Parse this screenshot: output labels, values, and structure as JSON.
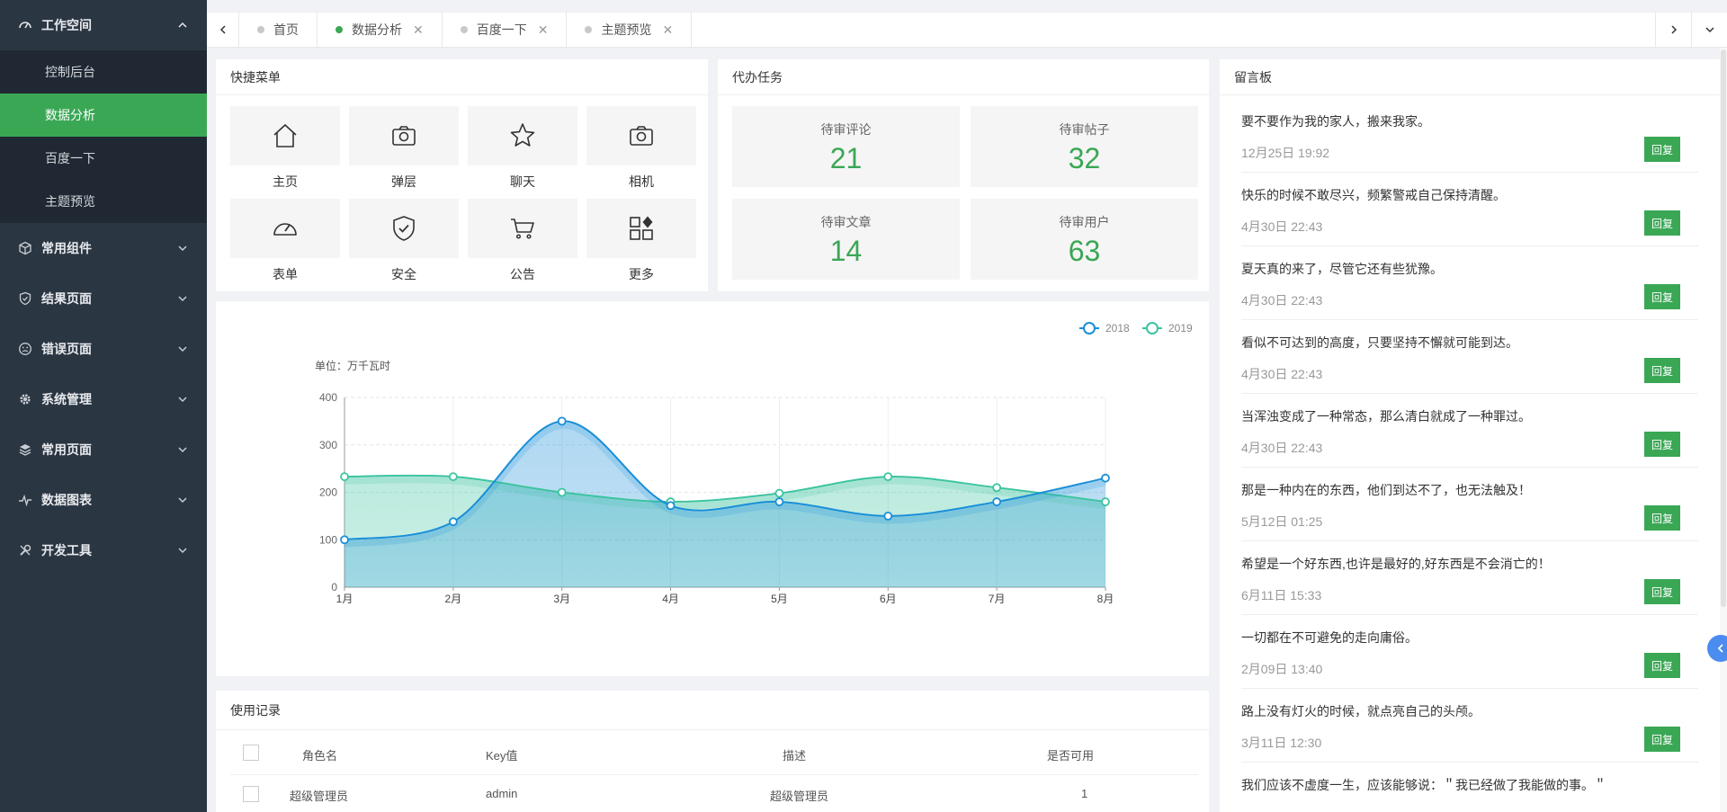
{
  "sidebar": {
    "workspace": {
      "label": "工作空间",
      "items": [
        "控制后台",
        "数据分析",
        "百度一下",
        "主题预览"
      ],
      "active_index": 1
    },
    "groups": [
      {
        "label": "常用组件",
        "icon": "cube-icon"
      },
      {
        "label": "结果页面",
        "icon": "shield-check-icon"
      },
      {
        "label": "错误页面",
        "icon": "sad-face-icon"
      },
      {
        "label": "系统管理",
        "icon": "gear-icon"
      },
      {
        "label": "常用页面",
        "icon": "layers-icon"
      },
      {
        "label": "数据图表",
        "icon": "pulse-icon"
      },
      {
        "label": "开发工具",
        "icon": "tools-icon"
      }
    ]
  },
  "tabs": [
    {
      "label": "首页",
      "closable": false,
      "active": false
    },
    {
      "label": "数据分析",
      "closable": true,
      "active": true
    },
    {
      "label": "百度一下",
      "closable": true,
      "active": false
    },
    {
      "label": "主题预览",
      "closable": true,
      "active": false
    }
  ],
  "tab_close_glyph": "✕",
  "quick_menu": {
    "title": "快捷菜单",
    "items": [
      {
        "label": "主页",
        "icon": "home-icon"
      },
      {
        "label": "弹层",
        "icon": "camera-icon"
      },
      {
        "label": "聊天",
        "icon": "star-icon"
      },
      {
        "label": "相机",
        "icon": "camera-icon"
      },
      {
        "label": "表单",
        "icon": "gauge-icon"
      },
      {
        "label": "安全",
        "icon": "shield-icon"
      },
      {
        "label": "公告",
        "icon": "cart-icon"
      },
      {
        "label": "更多",
        "icon": "apps-icon"
      }
    ]
  },
  "tasks": {
    "title": "代办任务",
    "items": [
      {
        "label": "待审评论",
        "value": "21"
      },
      {
        "label": "待审帖子",
        "value": "32"
      },
      {
        "label": "待审文章",
        "value": "14"
      },
      {
        "label": "待审用户",
        "value": "63"
      }
    ]
  },
  "board": {
    "title": "留言板",
    "reply_label": "回复",
    "messages": [
      {
        "text": "要不要作为我的家人，搬来我家。",
        "time": "12月25日 19:92"
      },
      {
        "text": "快乐的时候不敢尽兴，频繁警戒自己保持清醒。",
        "time": "4月30日 22:43"
      },
      {
        "text": "夏天真的来了，尽管它还有些犹豫。",
        "time": "4月30日 22:43"
      },
      {
        "text": "看似不可达到的高度，只要坚持不懈就可能到达。",
        "time": "4月30日 22:43"
      },
      {
        "text": "当浑浊变成了一种常态，那么清白就成了一种罪过。",
        "time": "4月30日 22:43"
      },
      {
        "text": "那是一种内在的东西，他们到达不了，也无法触及！",
        "time": "5月12日 01:25"
      },
      {
        "text": "希望是一个好东西,也许是最好的,好东西是不会消亡的！",
        "time": "6月11日 15:33"
      },
      {
        "text": "一切都在不可避免的走向庸俗。",
        "time": "2月09日 13:40"
      },
      {
        "text": "路上没有灯火的时候，就点亮自己的头颅。",
        "time": "3月11日 12:30"
      },
      {
        "text": "我们应该不虚度一生，应该能够说：＂我已经做了我能做的事。＂",
        "time": ""
      }
    ]
  },
  "chart_data": {
    "type": "line",
    "unit_label": "单位：万千瓦时",
    "categories": [
      "1月",
      "2月",
      "3月",
      "4月",
      "5月",
      "6月",
      "7月",
      "8月"
    ],
    "series": [
      {
        "name": "2018",
        "values": [
          100,
          138,
          350,
          172,
          180,
          150,
          180,
          230
        ],
        "color": "#1a8fd8"
      },
      {
        "name": "2019",
        "values": [
          233,
          233,
          200,
          180,
          198,
          233,
          210,
          180
        ],
        "color": "#3cc4a0"
      }
    ],
    "yticks": [
      0,
      100,
      200,
      300,
      400
    ],
    "ylim": [
      0,
      400
    ],
    "smooth": true,
    "area": true,
    "legend_position": "top-right"
  },
  "usage": {
    "title": "使用记录",
    "columns": [
      "角色名",
      "Key值",
      "描述",
      "是否可用"
    ],
    "first_row": [
      "超级管理员",
      "admin",
      "超级管理员",
      "1"
    ]
  },
  "colors": {
    "accent": "#3aa755",
    "sidebar": "#2b3643"
  }
}
